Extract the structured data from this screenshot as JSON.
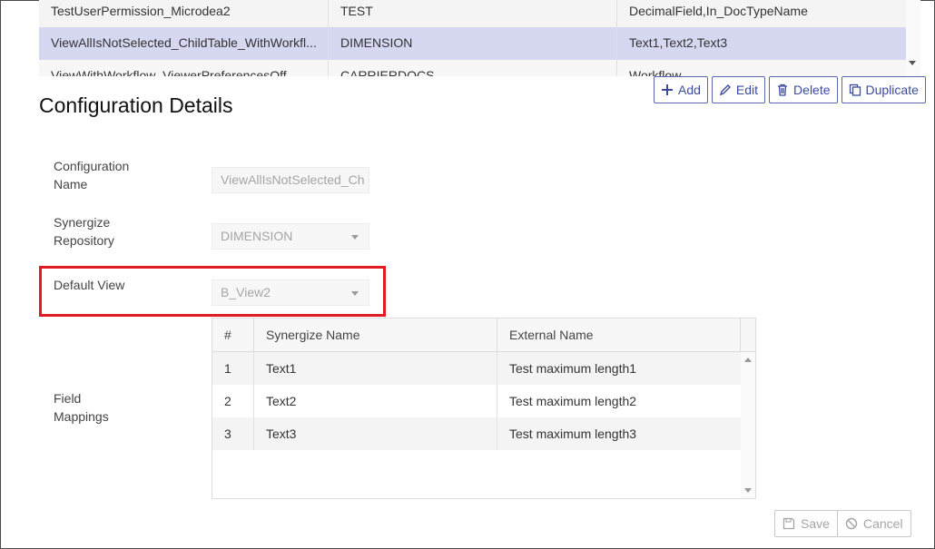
{
  "configs_table": {
    "rows": [
      [
        "TestUserPermission_Microdea2",
        "TEST",
        "DecimalField,In_DocTypeName"
      ],
      [
        "ViewAllIsNotSelected_ChildTable_WithWorkfl...",
        "DIMENSION",
        "Text1,Text2,Text3"
      ],
      [
        "ViewWithWorkflow_ViewerPreferencesOff",
        "CARRIERDOCS",
        "Workflow"
      ]
    ]
  },
  "actions": {
    "add": "Add",
    "edit": "Edit",
    "delete": "Delete",
    "duplicate": "Duplicate"
  },
  "title": "Configuration Details",
  "form": {
    "config_name": {
      "label_line1": "Configuration",
      "label_line2": "Name",
      "value": "ViewAllIsNotSelected_Ch"
    },
    "repository": {
      "label_line1": "Synergize",
      "label_line2": "Repository",
      "value": "DIMENSION"
    },
    "default_view": {
      "label": "Default View",
      "value": "B_View2"
    },
    "field_mappings": {
      "label_line1": "Field",
      "label_line2": "Mappings"
    }
  },
  "mappings": {
    "headers": [
      "#",
      "Synergize Name",
      "External Name"
    ],
    "rows": [
      [
        "1",
        "Text1",
        "Test maximum length1"
      ],
      [
        "2",
        "Text2",
        "Test maximum length2"
      ],
      [
        "3",
        "Text3",
        "Test maximum length3"
      ]
    ]
  },
  "footer": {
    "save": "Save",
    "cancel": "Cancel"
  },
  "colors": {
    "accent": "#3c4aa0",
    "selected_row": "#d6d8f2",
    "highlight": "#e11b22",
    "disabled": "#a5a5a5"
  },
  "icons": {
    "add": "plus-icon",
    "edit": "pencil-icon",
    "delete": "trash-icon",
    "duplicate": "copy-icon",
    "save": "floppy-icon",
    "cancel": "ban-icon"
  }
}
